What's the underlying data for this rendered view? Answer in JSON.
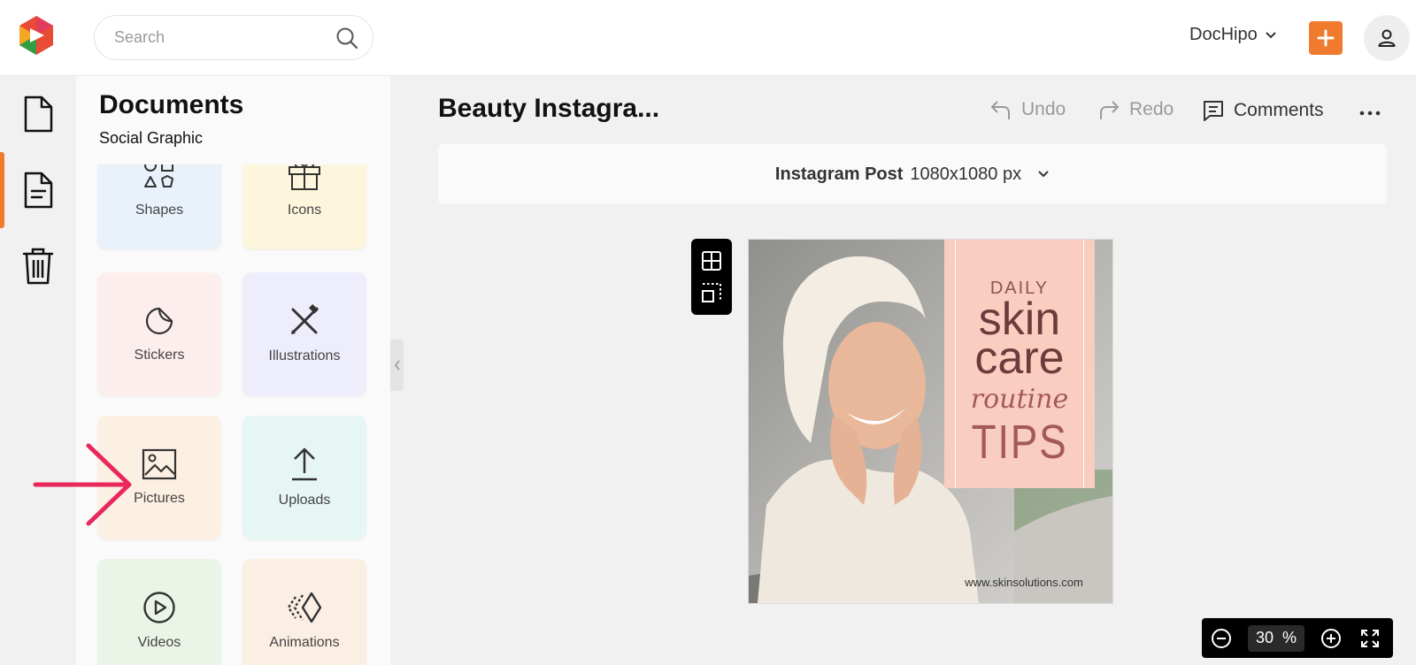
{
  "header": {
    "search_placeholder": "Search",
    "account_label": "DocHipo",
    "accent_color": "#f07b2e"
  },
  "rail": {
    "items": [
      {
        "name": "document-icon"
      },
      {
        "name": "file-text-icon",
        "active": true
      },
      {
        "name": "trash-icon"
      }
    ]
  },
  "panel": {
    "title": "Documents",
    "subtitle": "Social Graphic",
    "tiles": [
      {
        "label": "Shapes",
        "icon": "shapes-icon",
        "bg": "#e9f1fb"
      },
      {
        "label": "Icons",
        "icon": "gift-icon",
        "bg": "#fdf5dc"
      },
      {
        "label": "Stickers",
        "icon": "sticker-icon",
        "bg": "#fdeeee"
      },
      {
        "label": "Illustrations",
        "icon": "pen-brush-icon",
        "bg": "#ededfb"
      },
      {
        "label": "Pictures",
        "icon": "image-icon",
        "bg": "#fcf0e2"
      },
      {
        "label": "Uploads",
        "icon": "upload-icon",
        "bg": "#e6f6f5"
      },
      {
        "label": "Videos",
        "icon": "play-circle-icon",
        "bg": "#ebf5e7"
      },
      {
        "label": "Animations",
        "icon": "animation-icon",
        "bg": "#fbeee3"
      }
    ]
  },
  "editor": {
    "doc_title": "Beauty Instagra...",
    "undo_label": "Undo",
    "redo_label": "Redo",
    "comments_label": "Comments",
    "format_name": "Instagram Post",
    "format_size": "1080x1080 px"
  },
  "design": {
    "line_daily": "DAILY",
    "line_skin": "skin",
    "line_care": "care",
    "line_routine": "routine",
    "line_tips": "TIPS",
    "url": "www.skinsolutions.com"
  },
  "zoom": {
    "value": "30",
    "unit": "%"
  }
}
